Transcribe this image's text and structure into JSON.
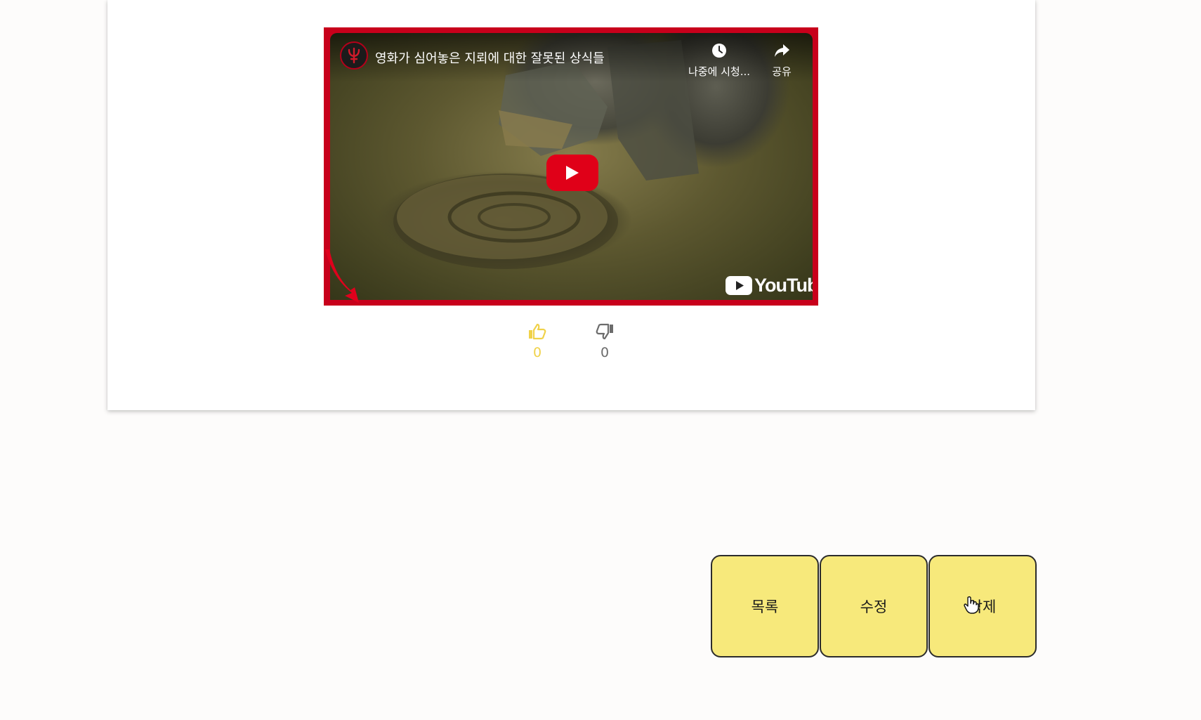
{
  "video": {
    "title": "영화가 심어놓은 지뢰에 대한 잘못된 상식들",
    "watch_later_label": "나중에 시청...",
    "share_label": "공유",
    "brand_label": "YouTube",
    "channel_icon": "trident-logo",
    "accent_color": "#c8001b"
  },
  "reactions": {
    "like_icon": "thumbs-up-icon",
    "like_count": "0",
    "dislike_icon": "thumbs-down-icon",
    "dislike_count": "0",
    "like_color": "#f0d24a",
    "dislike_color": "#6c6c6c"
  },
  "actions": {
    "list_label": "목록",
    "edit_label": "수정",
    "delete_label": "삭제",
    "button_color": "#f7e97b"
  }
}
